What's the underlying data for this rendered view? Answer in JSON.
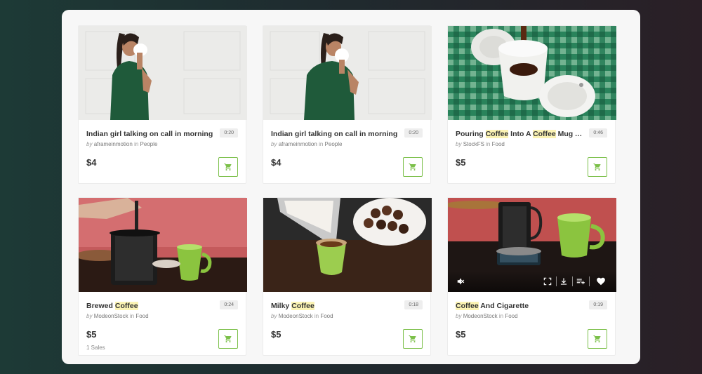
{
  "cards": [
    {
      "title": "Indian girl talking on call in morning",
      "duration": "0:20",
      "by": "by",
      "author": "aframeinmotion",
      "in": "in",
      "category": "People",
      "price": "$4",
      "sales": "",
      "thumbnail": "woman-phone-white-wall"
    },
    {
      "title": "Indian girl talking on call in morning",
      "duration": "0:20",
      "by": "by",
      "author": "aframeinmotion",
      "in": "in",
      "category": "People",
      "price": "$4",
      "sales": "",
      "thumbnail": "woman-phone-white-wall"
    },
    {
      "title_parts": [
        "Pouring ",
        "Coffee",
        " Into A ",
        "Coffee",
        " Mug A..."
      ],
      "duration": "0:46",
      "by": "by",
      "author": "StockFS",
      "in": "in",
      "category": "Food",
      "price": "$5",
      "sales": "",
      "thumbnail": "coffee-pour-plaid"
    },
    {
      "title_parts": [
        "Brewed ",
        "Coffee"
      ],
      "duration": "0:24",
      "by": "by",
      "author": "ModeonStock",
      "in": "in",
      "category": "Food",
      "price": "$5",
      "sales": "1 Sales",
      "thumbnail": "french-press-green-mug"
    },
    {
      "title_parts": [
        "Milky ",
        "Coffee"
      ],
      "duration": "0:18",
      "by": "by",
      "author": "ModeonStock",
      "in": "in",
      "category": "Food",
      "price": "$5",
      "sales": "",
      "thumbnail": "milk-pour-cookies"
    },
    {
      "title_parts": [
        "",
        "Coffee",
        " And Cigarette"
      ],
      "duration": "0:19",
      "by": "by",
      "author": "ModeonStock",
      "in": "in",
      "category": "Food",
      "price": "$5",
      "sales": "",
      "thumbnail": "coffee-ashtray",
      "player_controls": [
        "mute-icon",
        "fullscreen-icon",
        "download-icon",
        "add-to-playlist-icon",
        "heart-icon"
      ]
    }
  ],
  "colors": {
    "accent_green": "#7cc04a",
    "highlight": "#fbf3b4"
  },
  "icons": {
    "cart": "shopping-cart-icon",
    "chevron": "chevron-down-icon"
  }
}
